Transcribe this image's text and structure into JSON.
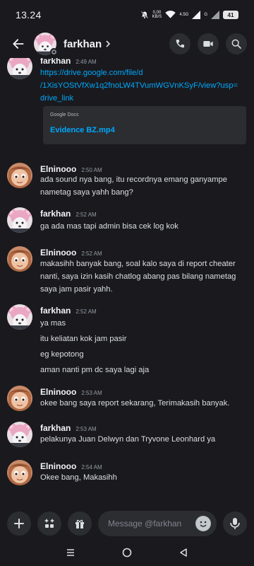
{
  "status_bar": {
    "time": "13.24",
    "net_speed_value": "0,00",
    "net_speed_unit": "KB/S",
    "network_4g": "4.5G",
    "network_g": "G",
    "battery": "41",
    "icons": [
      "bell-off-icon",
      "wifi-icon",
      "signal-icon",
      "battery-icon"
    ]
  },
  "header": {
    "title": "farkhan",
    "icons": [
      "back-arrow-icon",
      "chevron-right-icon",
      "voice-call-icon",
      "video-call-icon",
      "search-icon"
    ]
  },
  "messages": [
    {
      "author": "farkhan",
      "time": "2:49 AM",
      "avatar": "bear-avatar",
      "lines": [
        "https://drive.google.com/file/d",
        "/1XisYOStVfXw1q2fnoLW4TVumWGVnKSyF/view?usp=",
        "drive_link"
      ],
      "embed": {
        "provider": "Google Docs",
        "title": "Evidence BZ.mp4"
      }
    },
    {
      "author": "Elninooo",
      "time": "2:50 AM",
      "avatar": "cartoon-avatar",
      "lines": [
        "ada sound nya bang, itu recordnya emang ganyampe",
        "nametag saya yahh bang?"
      ]
    },
    {
      "author": "farkhan",
      "time": "2:52 AM",
      "avatar": "bear-avatar",
      "lines": [
        "ga ada mas tapi admin bisa cek log kok"
      ]
    },
    {
      "author": "Elninooo",
      "time": "2:52 AM",
      "avatar": "cartoon-avatar",
      "lines": [
        "makasihh banyak bang, soal kalo saya di report cheater",
        "nanti, saya izin kasih chatlog abang pas bilang nametag",
        "saya jam pasir yahh."
      ]
    },
    {
      "author": "farkhan",
      "time": "2:52 AM",
      "avatar": "bear-avatar",
      "lines": [
        "ya mas",
        "itu keliatan kok jam pasir",
        "eg kepotong",
        "aman nanti pm dc saya lagi aja"
      ]
    },
    {
      "author": "Elninooo",
      "time": "2:53 AM",
      "avatar": "cartoon-avatar",
      "lines": [
        "okee bang saya report sekarang, Terimakasih banyak."
      ]
    },
    {
      "author": "farkhan",
      "time": "2:53 AM",
      "avatar": "bear-avatar",
      "lines": [
        "pelakunya Juan Delwyn dan Tryvone Leonhard ya"
      ]
    },
    {
      "author": "Elninooo",
      "time": "2:54 AM",
      "avatar": "cartoon-avatar",
      "lines": [
        "Okee bang, Makasihh"
      ]
    }
  ],
  "composer": {
    "placeholder": "Message @farkhan",
    "icons": [
      "plus-icon",
      "apps-icon",
      "gift-icon",
      "emoji-icon",
      "mic-icon"
    ]
  },
  "navbar": {
    "icons": [
      "recents-icon",
      "home-icon",
      "back-icon"
    ]
  },
  "colors": {
    "background": "#1a1a1e",
    "surface": "#2b2d31",
    "link": "#00a8fc",
    "text": "#dbdee1",
    "muted": "#949ba4"
  }
}
